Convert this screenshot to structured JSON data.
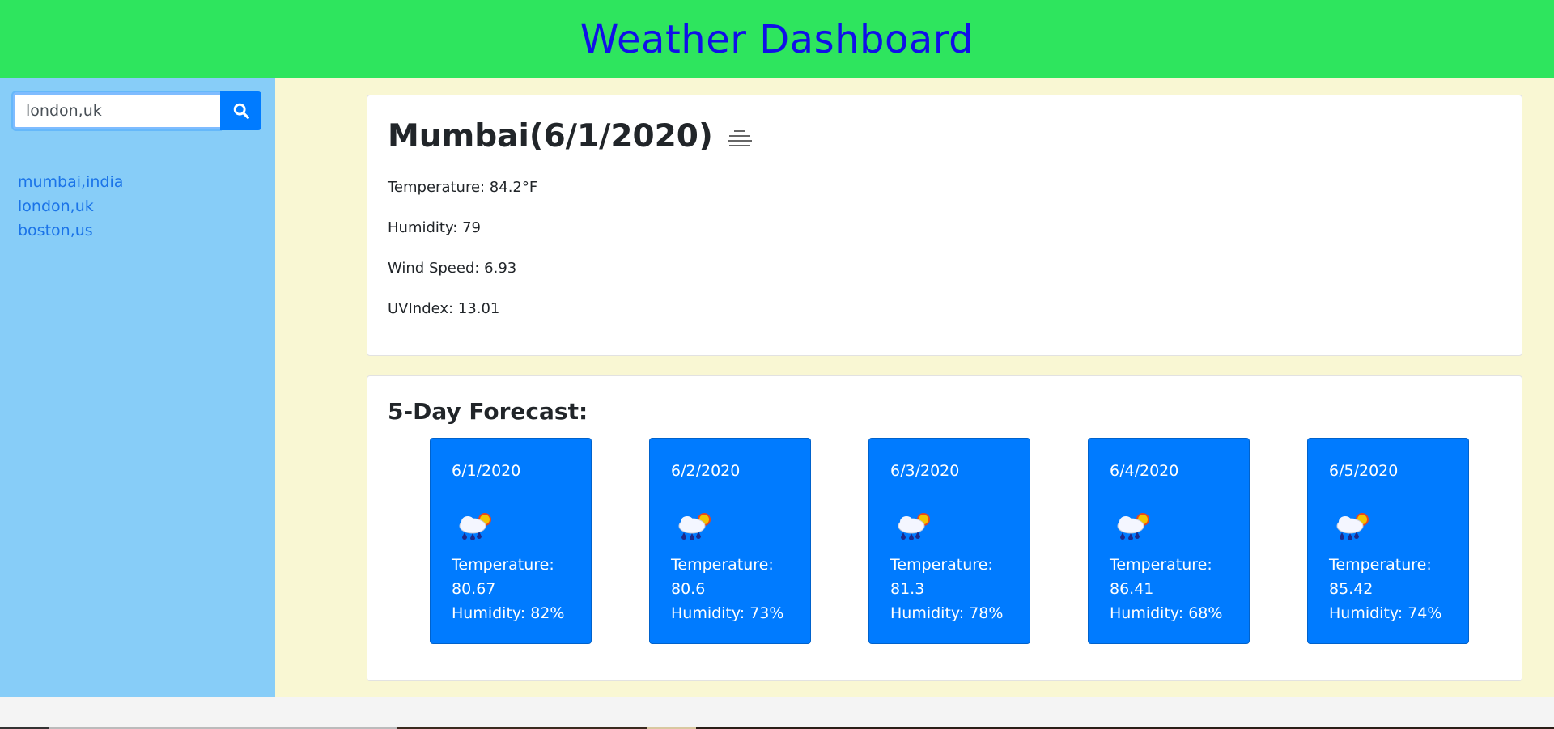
{
  "header": {
    "title": "Weather Dashboard"
  },
  "search": {
    "value": "london,uk",
    "placeholder": ""
  },
  "history": [
    "mumbai,india",
    "london,uk",
    "boston,us"
  ],
  "current": {
    "title": "Mumbai(6/1/2020)",
    "icon": "mist-icon",
    "temperature": "Temperature: 84.2°F",
    "humidity": "Humidity: 79",
    "wind": "Wind Speed: 6.93",
    "uv": "UVIndex: 13.01"
  },
  "forecast": {
    "title": "5-Day Forecast:",
    "days": [
      {
        "date": "6/1/2020",
        "icon": "rain-sun-icon",
        "temp_label": "Temperature:",
        "temp": "80.67",
        "humidity": "Humidity: 82%"
      },
      {
        "date": "6/2/2020",
        "icon": "rain-sun-icon",
        "temp_label": "Temperature:",
        "temp": "80.6",
        "humidity": "Humidity: 73%"
      },
      {
        "date": "6/3/2020",
        "icon": "rain-sun-icon",
        "temp_label": "Temperature:",
        "temp": "81.3",
        "humidity": "Humidity: 78%"
      },
      {
        "date": "6/4/2020",
        "icon": "rain-sun-icon",
        "temp_label": "Temperature:",
        "temp": "86.41",
        "humidity": "Humidity: 68%"
      },
      {
        "date": "6/5/2020",
        "icon": "rain-sun-icon",
        "temp_label": "Temperature:",
        "temp": "85.42",
        "humidity": "Humidity: 74%"
      }
    ]
  },
  "colors": {
    "header_bg": "#2ee55e",
    "title_text": "#1010e8",
    "sidebar_bg": "#87cdf8",
    "main_bg": "#f9f7d3",
    "accent": "#007bff"
  }
}
